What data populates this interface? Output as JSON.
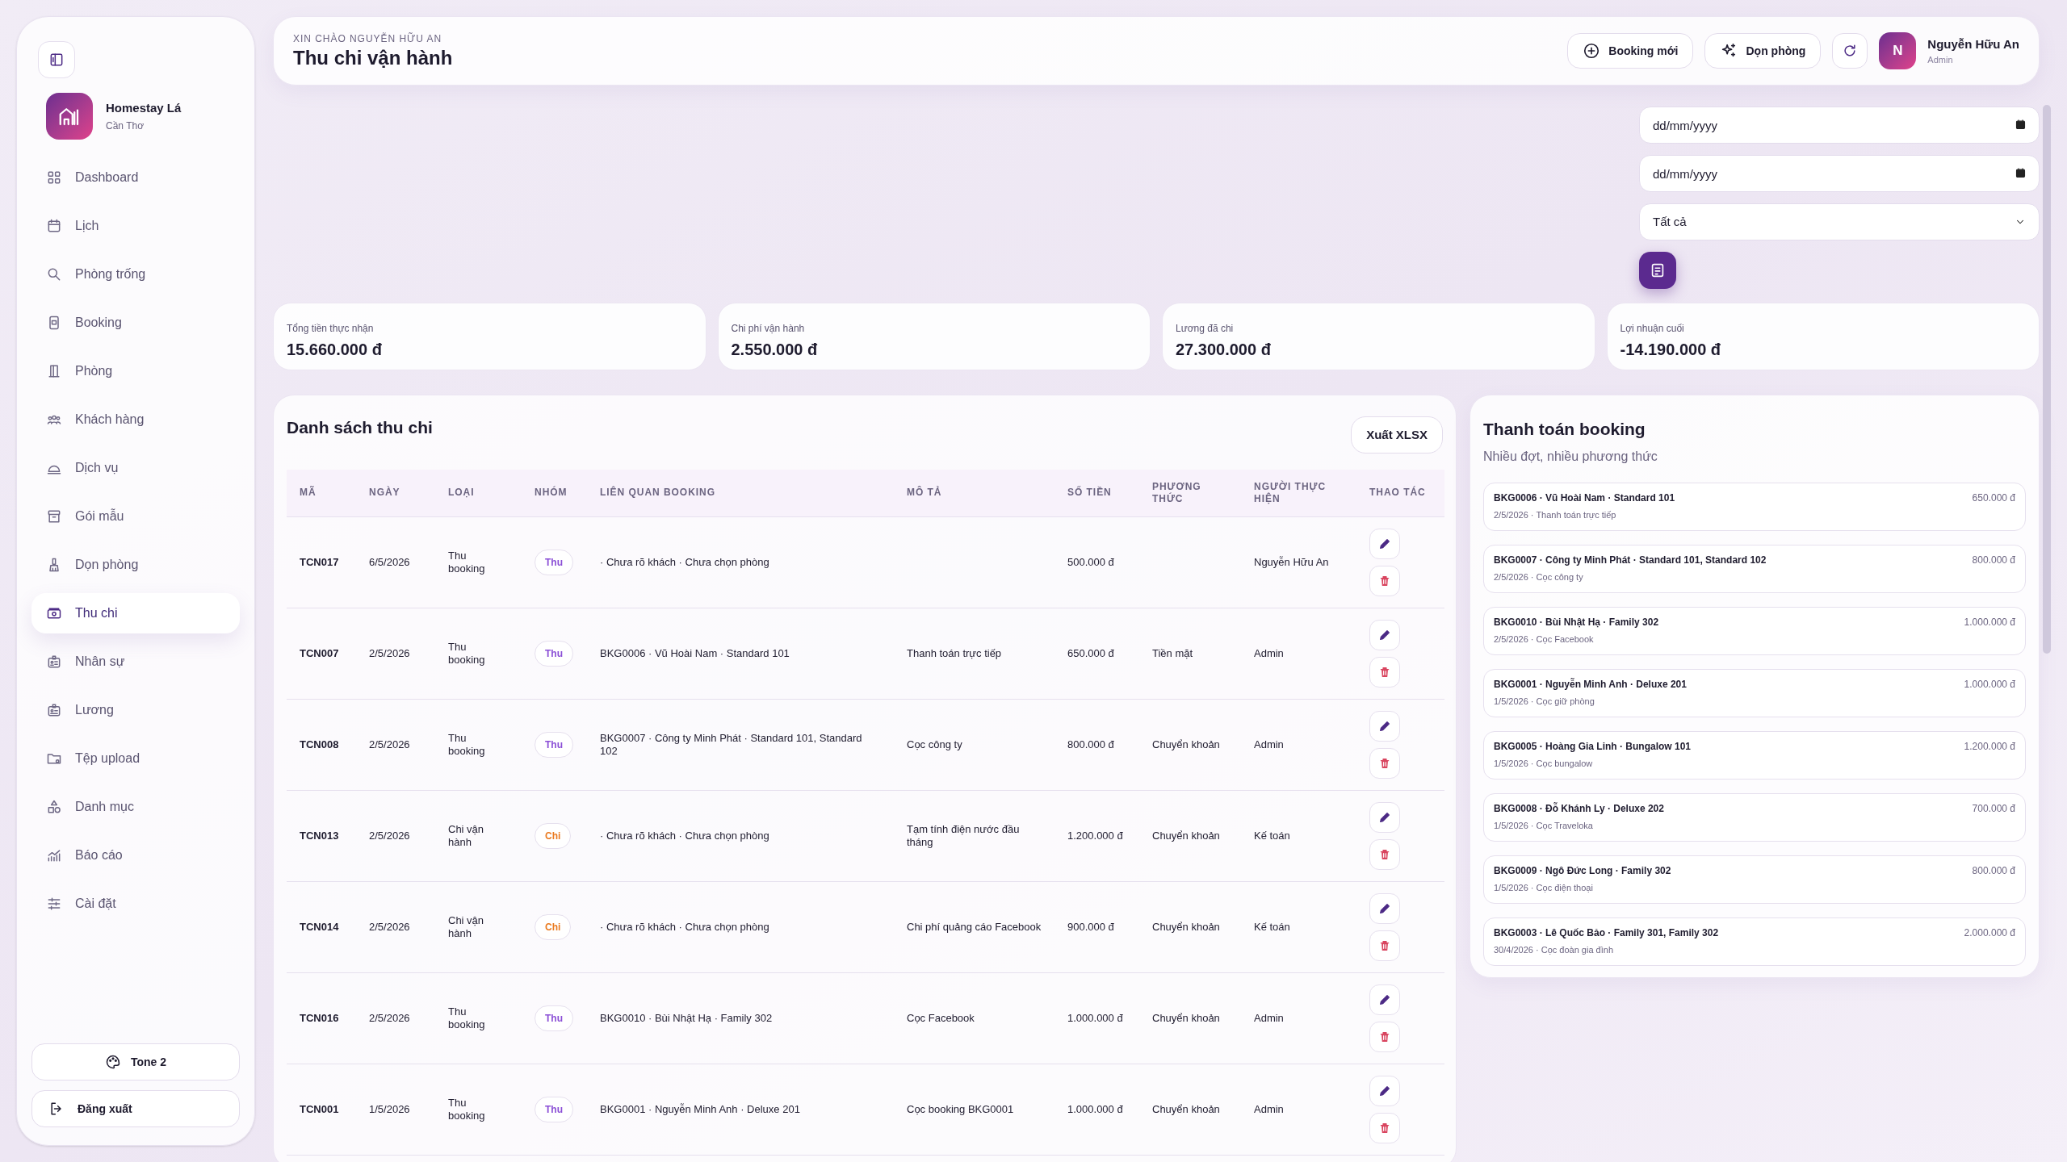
{
  "sidebar": {
    "brand": {
      "name": "Homestay Lá",
      "location": "Cần Thơ"
    },
    "items": [
      {
        "label": "Dashboard",
        "selected": false
      },
      {
        "label": "Lịch",
        "selected": false
      },
      {
        "label": "Phòng trống",
        "selected": false
      },
      {
        "label": "Booking",
        "selected": false
      },
      {
        "label": "Phòng",
        "selected": false
      },
      {
        "label": "Khách hàng",
        "selected": false
      },
      {
        "label": "Dịch vụ",
        "selected": false
      },
      {
        "label": "Gói mẫu",
        "selected": false
      },
      {
        "label": "Dọn phòng",
        "selected": false
      },
      {
        "label": "Thu chi",
        "selected": true
      },
      {
        "label": "Nhân sự",
        "selected": false
      },
      {
        "label": "Lương",
        "selected": false
      },
      {
        "label": "Tệp upload",
        "selected": false
      },
      {
        "label": "Danh mục",
        "selected": false
      },
      {
        "label": "Báo cáo",
        "selected": false
      },
      {
        "label": "Cài đặt",
        "selected": false
      }
    ],
    "theme_button": "Tone 2",
    "logout_button": "Đăng xuất"
  },
  "header": {
    "greeting": "XIN CHÀO NGUYỄN HỮU AN",
    "title": "Thu chi vận hành",
    "buttons": [
      "Booking mới",
      "Dọn phòng"
    ],
    "user": {
      "initial": "N",
      "name": "Nguyễn Hữu An",
      "role": "Admin"
    }
  },
  "filters": {
    "date_from": {
      "placeholder": "dd/mm/yyyy"
    },
    "date_to": {
      "placeholder": "dd/mm/yyyy"
    },
    "type_select": "Tất cả"
  },
  "stats": [
    {
      "label": "Tổng tiền thực nhận",
      "value": "15.660.000 đ"
    },
    {
      "label": "Chi phí vận hành",
      "value": "2.550.000 đ"
    },
    {
      "label": "Lương đã chi",
      "value": "27.300.000 đ"
    },
    {
      "label": "Lợi nhuận cuối",
      "value": "-14.190.000 đ"
    }
  ],
  "table": {
    "title": "Danh sách thu chi",
    "export_button": "Xuất XLSX",
    "columns": [
      "MÃ",
      "NGÀY",
      "LOẠI",
      "NHÓM",
      "LIÊN QUAN BOOKING",
      "MÔ TẢ",
      "SỐ TIỀN",
      "PHƯƠNG THỨC",
      "NGƯỜI THỰC HIỆN",
      "THAO TÁC"
    ],
    "rows": [
      {
        "code": "TCN017",
        "date": "6/5/2026",
        "type": "Thu booking",
        "group": "Thu",
        "kind": "income",
        "booking": "· Chưa rõ khách · Chưa chọn phòng",
        "description": "",
        "amount": "500.000 đ",
        "method": "",
        "person": "Nguyễn Hữu An"
      },
      {
        "code": "TCN007",
        "date": "2/5/2026",
        "type": "Thu booking",
        "group": "Thu",
        "kind": "income",
        "booking": "BKG0006 · Vũ Hoài Nam · Standard 101",
        "description": "Thanh toán trực tiếp",
        "amount": "650.000 đ",
        "method": "Tiền mặt",
        "person": "Admin"
      },
      {
        "code": "TCN008",
        "date": "2/5/2026",
        "type": "Thu booking",
        "group": "Thu",
        "kind": "income",
        "booking": "BKG0007 · Công ty Minh Phát · Standard 101, Standard 102",
        "description": "Cọc công ty",
        "amount": "800.000 đ",
        "method": "Chuyển khoản",
        "person": "Admin"
      },
      {
        "code": "TCN013",
        "date": "2/5/2026",
        "type": "Chi vận hành",
        "group": "Chi",
        "kind": "expense",
        "booking": "· Chưa rõ khách · Chưa chọn phòng",
        "description": "Tạm tính điện nước đầu tháng",
        "amount": "1.200.000 đ",
        "method": "Chuyển khoản",
        "person": "Kế toán"
      },
      {
        "code": "TCN014",
        "date": "2/5/2026",
        "type": "Chi vận hành",
        "group": "Chi",
        "kind": "expense",
        "booking": "· Chưa rõ khách · Chưa chọn phòng",
        "description": "Chi phí quảng cáo Facebook",
        "amount": "900.000 đ",
        "method": "Chuyển khoản",
        "person": "Kế toán"
      },
      {
        "code": "TCN016",
        "date": "2/5/2026",
        "type": "Thu booking",
        "group": "Thu",
        "kind": "income",
        "booking": "BKG0010 · Bùi Nhật Hạ · Family 302",
        "description": "Cọc Facebook",
        "amount": "1.000.000 đ",
        "method": "Chuyển khoản",
        "person": "Admin"
      },
      {
        "code": "TCN001",
        "date": "1/5/2026",
        "type": "Thu booking",
        "group": "Thu",
        "kind": "income",
        "booking": "BKG0001 · Nguyễn Minh Anh · Deluxe 201",
        "description": "Cọc booking BKG0001",
        "amount": "1.000.000 đ",
        "method": "Chuyển khoản",
        "person": "Admin"
      }
    ]
  },
  "payments": {
    "title": "Thanh toán booking",
    "subtitle": "Nhiều đợt, nhiều phương thức",
    "items": [
      {
        "title": "BKG0006 · Vũ Hoài Nam · Standard 101",
        "detail": "2/5/2026 · Thanh toán trực tiếp",
        "amount": "650.000 đ"
      },
      {
        "title": "BKG0007 · Công ty Minh Phát · Standard 101, Standard 102",
        "detail": "2/5/2026 · Cọc công ty",
        "amount": "800.000 đ"
      },
      {
        "title": "BKG0010 · Bùi Nhật Hạ · Family 302",
        "detail": "2/5/2026 · Cọc Facebook",
        "amount": "1.000.000 đ"
      },
      {
        "title": "BKG0001 · Nguyễn Minh Anh · Deluxe 201",
        "detail": "1/5/2026 · Cọc giữ phòng",
        "amount": "1.000.000 đ"
      },
      {
        "title": "BKG0005 · Hoàng Gia Linh · Bungalow 101",
        "detail": "1/5/2026 · Cọc bungalow",
        "amount": "1.200.000 đ"
      },
      {
        "title": "BKG0008 · Đỗ Khánh Ly · Deluxe 202",
        "detail": "1/5/2026 · Cọc Traveloka",
        "amount": "700.000 đ"
      },
      {
        "title": "BKG0009 · Ngô Đức Long · Family 302",
        "detail": "1/5/2026 · Cọc điện thoại",
        "amount": "800.000 đ"
      },
      {
        "title": "BKG0003 · Lê Quốc Bảo · Family 301, Family 302",
        "detail": "30/4/2026 · Cọc đoàn gia đình",
        "amount": "2.000.000 đ"
      }
    ]
  }
}
